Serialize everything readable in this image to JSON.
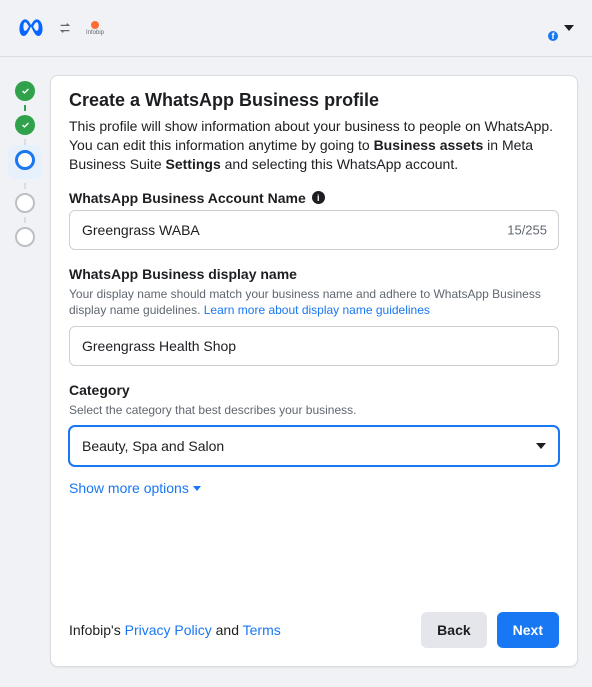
{
  "topbar": {
    "infobip_label": "Infobip"
  },
  "card": {
    "title": "Create a WhatsApp Business profile",
    "intro_a": "This profile will show information about your business to people on WhatsApp. You can edit this information anytime by going to ",
    "intro_b1": "Business assets",
    "intro_c": " in Meta Business Suite ",
    "intro_b2": "Settings",
    "intro_d": " and selecting this WhatsApp account."
  },
  "account_name": {
    "label": "WhatsApp Business Account Name",
    "value": "Greengrass WABA",
    "count": "15/255"
  },
  "display_name": {
    "label": "WhatsApp Business display name",
    "help": "Your display name should match your business name and adhere to WhatsApp Business display name guidelines. ",
    "help_link": "Learn more about display name guidelines",
    "value": "Greengrass Health Shop"
  },
  "category": {
    "label": "Category",
    "help": "Select the category that best describes your business.",
    "selected": "Beauty, Spa and Salon"
  },
  "show_more": "Show more options",
  "footer": {
    "legal_prefix": "Infobip's ",
    "privacy": "Privacy Policy",
    "and": " and ",
    "terms": "Terms",
    "back": "Back",
    "next": "Next"
  }
}
